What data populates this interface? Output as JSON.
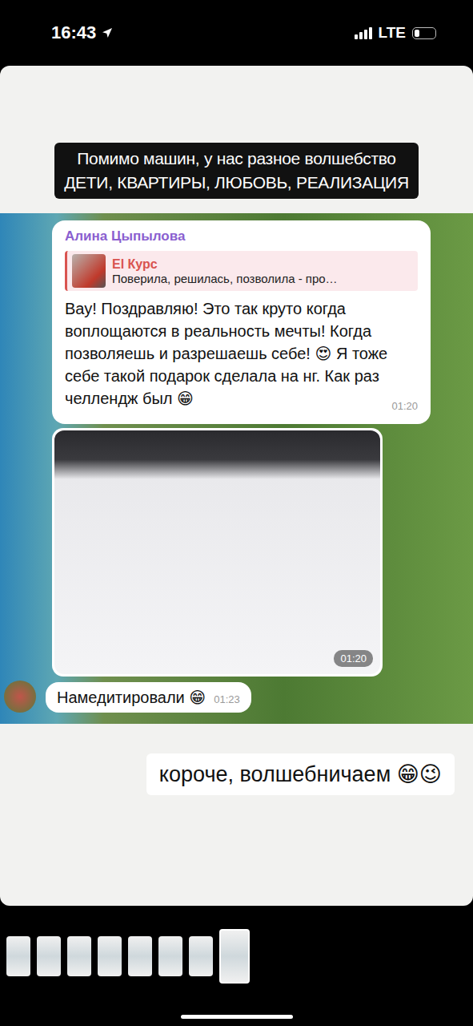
{
  "status_bar": {
    "time": "16:43",
    "network": "LTE",
    "signal_bars": 4,
    "battery_level": 0.25
  },
  "story": {
    "caption": [
      "Помимо машин, у нас разное волшебство",
      "ДЕТИ, КВАРТИРЫ, ЛЮБОВЬ, РЕАЛИЗАЦИЯ"
    ],
    "chat": {
      "messages": [
        {
          "kind": "text",
          "sender": "Алина Цыпылова",
          "reply": {
            "title": "El Курс",
            "text": "Поверила, решилась, позволила - про…"
          },
          "text": "Вау! Поздравляю! Это так круто когда воплощаются в реальность мечты! Когда позволяешь и разрешаешь себе! 😍 Я тоже себе такой подарок сделала на нг. Как раз челлендж был 😁",
          "time": "01:20"
        },
        {
          "kind": "photo",
          "time": "01:20"
        },
        {
          "kind": "short",
          "text": "Намедитировали 😁",
          "time": "01:23"
        }
      ]
    },
    "sticker": "короче, волшебничаем 😁😉"
  },
  "thumbnails": [
    {
      "selected": false
    },
    {
      "selected": false
    },
    {
      "selected": false
    },
    {
      "selected": false
    },
    {
      "selected": false
    },
    {
      "selected": false
    },
    {
      "selected": false
    },
    {
      "selected": true
    }
  ]
}
